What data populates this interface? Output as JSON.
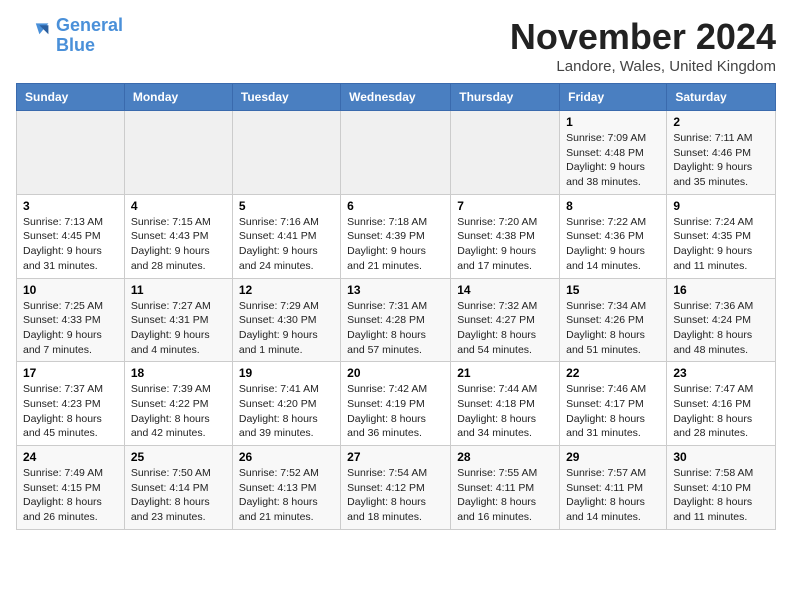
{
  "logo": {
    "line1": "General",
    "line2": "Blue"
  },
  "title": "November 2024",
  "location": "Landore, Wales, United Kingdom",
  "days_of_week": [
    "Sunday",
    "Monday",
    "Tuesday",
    "Wednesday",
    "Thursday",
    "Friday",
    "Saturday"
  ],
  "weeks": [
    [
      {
        "day": "",
        "info": ""
      },
      {
        "day": "",
        "info": ""
      },
      {
        "day": "",
        "info": ""
      },
      {
        "day": "",
        "info": ""
      },
      {
        "day": "",
        "info": ""
      },
      {
        "day": "1",
        "info": "Sunrise: 7:09 AM\nSunset: 4:48 PM\nDaylight: 9 hours and 38 minutes."
      },
      {
        "day": "2",
        "info": "Sunrise: 7:11 AM\nSunset: 4:46 PM\nDaylight: 9 hours and 35 minutes."
      }
    ],
    [
      {
        "day": "3",
        "info": "Sunrise: 7:13 AM\nSunset: 4:45 PM\nDaylight: 9 hours and 31 minutes."
      },
      {
        "day": "4",
        "info": "Sunrise: 7:15 AM\nSunset: 4:43 PM\nDaylight: 9 hours and 28 minutes."
      },
      {
        "day": "5",
        "info": "Sunrise: 7:16 AM\nSunset: 4:41 PM\nDaylight: 9 hours and 24 minutes."
      },
      {
        "day": "6",
        "info": "Sunrise: 7:18 AM\nSunset: 4:39 PM\nDaylight: 9 hours and 21 minutes."
      },
      {
        "day": "7",
        "info": "Sunrise: 7:20 AM\nSunset: 4:38 PM\nDaylight: 9 hours and 17 minutes."
      },
      {
        "day": "8",
        "info": "Sunrise: 7:22 AM\nSunset: 4:36 PM\nDaylight: 9 hours and 14 minutes."
      },
      {
        "day": "9",
        "info": "Sunrise: 7:24 AM\nSunset: 4:35 PM\nDaylight: 9 hours and 11 minutes."
      }
    ],
    [
      {
        "day": "10",
        "info": "Sunrise: 7:25 AM\nSunset: 4:33 PM\nDaylight: 9 hours and 7 minutes."
      },
      {
        "day": "11",
        "info": "Sunrise: 7:27 AM\nSunset: 4:31 PM\nDaylight: 9 hours and 4 minutes."
      },
      {
        "day": "12",
        "info": "Sunrise: 7:29 AM\nSunset: 4:30 PM\nDaylight: 9 hours and 1 minute."
      },
      {
        "day": "13",
        "info": "Sunrise: 7:31 AM\nSunset: 4:28 PM\nDaylight: 8 hours and 57 minutes."
      },
      {
        "day": "14",
        "info": "Sunrise: 7:32 AM\nSunset: 4:27 PM\nDaylight: 8 hours and 54 minutes."
      },
      {
        "day": "15",
        "info": "Sunrise: 7:34 AM\nSunset: 4:26 PM\nDaylight: 8 hours and 51 minutes."
      },
      {
        "day": "16",
        "info": "Sunrise: 7:36 AM\nSunset: 4:24 PM\nDaylight: 8 hours and 48 minutes."
      }
    ],
    [
      {
        "day": "17",
        "info": "Sunrise: 7:37 AM\nSunset: 4:23 PM\nDaylight: 8 hours and 45 minutes."
      },
      {
        "day": "18",
        "info": "Sunrise: 7:39 AM\nSunset: 4:22 PM\nDaylight: 8 hours and 42 minutes."
      },
      {
        "day": "19",
        "info": "Sunrise: 7:41 AM\nSunset: 4:20 PM\nDaylight: 8 hours and 39 minutes."
      },
      {
        "day": "20",
        "info": "Sunrise: 7:42 AM\nSunset: 4:19 PM\nDaylight: 8 hours and 36 minutes."
      },
      {
        "day": "21",
        "info": "Sunrise: 7:44 AM\nSunset: 4:18 PM\nDaylight: 8 hours and 34 minutes."
      },
      {
        "day": "22",
        "info": "Sunrise: 7:46 AM\nSunset: 4:17 PM\nDaylight: 8 hours and 31 minutes."
      },
      {
        "day": "23",
        "info": "Sunrise: 7:47 AM\nSunset: 4:16 PM\nDaylight: 8 hours and 28 minutes."
      }
    ],
    [
      {
        "day": "24",
        "info": "Sunrise: 7:49 AM\nSunset: 4:15 PM\nDaylight: 8 hours and 26 minutes."
      },
      {
        "day": "25",
        "info": "Sunrise: 7:50 AM\nSunset: 4:14 PM\nDaylight: 8 hours and 23 minutes."
      },
      {
        "day": "26",
        "info": "Sunrise: 7:52 AM\nSunset: 4:13 PM\nDaylight: 8 hours and 21 minutes."
      },
      {
        "day": "27",
        "info": "Sunrise: 7:54 AM\nSunset: 4:12 PM\nDaylight: 8 hours and 18 minutes."
      },
      {
        "day": "28",
        "info": "Sunrise: 7:55 AM\nSunset: 4:11 PM\nDaylight: 8 hours and 16 minutes."
      },
      {
        "day": "29",
        "info": "Sunrise: 7:57 AM\nSunset: 4:11 PM\nDaylight: 8 hours and 14 minutes."
      },
      {
        "day": "30",
        "info": "Sunrise: 7:58 AM\nSunset: 4:10 PM\nDaylight: 8 hours and 11 minutes."
      }
    ]
  ]
}
